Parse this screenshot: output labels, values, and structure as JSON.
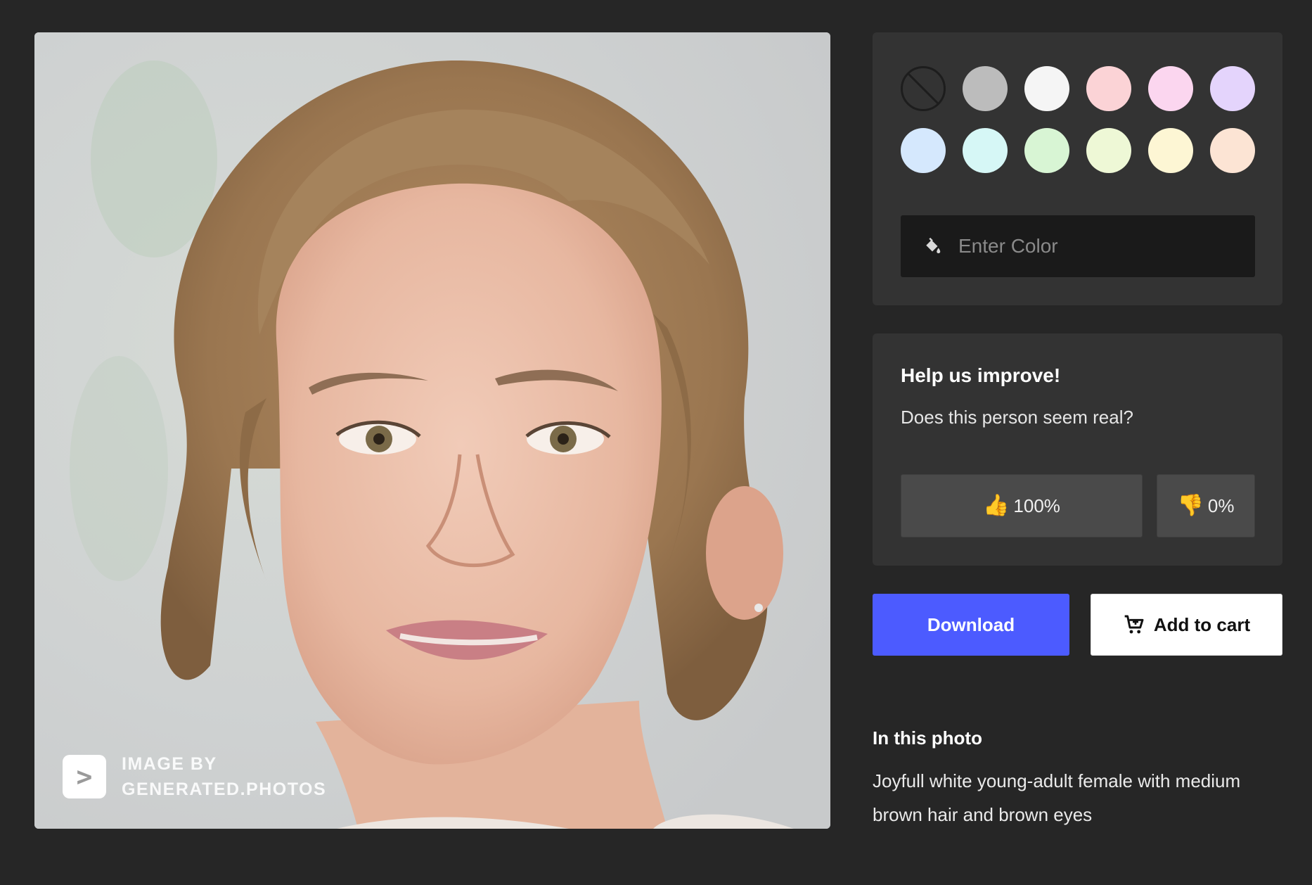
{
  "photo": {
    "watermark_logo": ">",
    "watermark_text": "IMAGE BY GENERATED.PHOTOS"
  },
  "palette": {
    "colors": [
      "none",
      "#bcbcbc",
      "#f5f5f5",
      "#fbd3d6",
      "#fbd6ef",
      "#e4d4fc",
      "#d5e8fd",
      "#d6f7f6",
      "#d8f5d4",
      "#eef8d6",
      "#fdf6d4",
      "#fce4d4"
    ],
    "input_placeholder": "Enter Color",
    "input_icon": "paint-bucket-icon"
  },
  "feedback": {
    "title": "Help us improve!",
    "question": "Does this person seem real?",
    "up_icon": "👍",
    "up_percent": "100%",
    "down_icon": "👎",
    "down_percent": "0%"
  },
  "actions": {
    "download_label": "Download",
    "cart_label": "Add to cart",
    "cart_icon": "cart-icon",
    "accent": "#4c5bff"
  },
  "in_photo": {
    "title": "In this photo",
    "description": "Joyfull white young-adult female with medium brown hair and brown eyes"
  }
}
